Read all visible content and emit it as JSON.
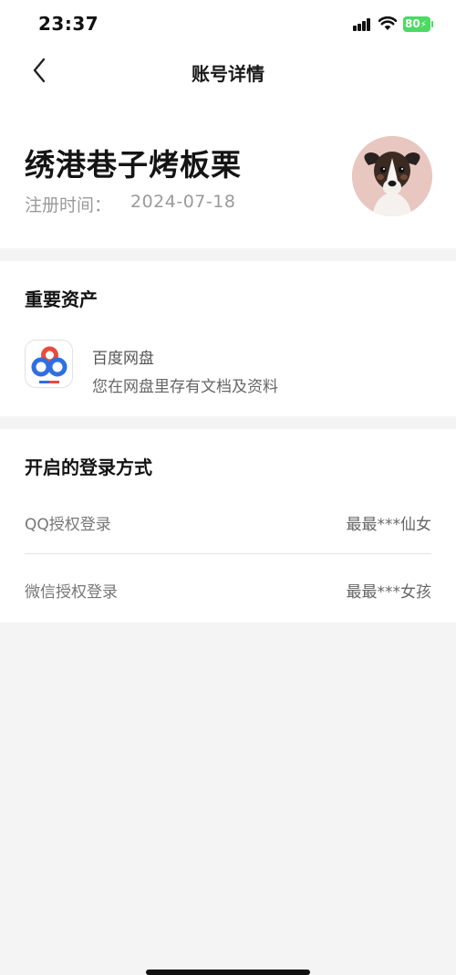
{
  "status_bar": {
    "time": "23:37",
    "battery": "80",
    "icons": [
      "signal-icon",
      "wifi-icon",
      "battery-icon"
    ]
  },
  "nav": {
    "title": "账号详情",
    "back_icon": "chevron-left-icon"
  },
  "profile": {
    "username": "绣港巷子烤板栗",
    "registered_label": "注册时间：",
    "registered_date": "2024-07-18",
    "avatar_icon": "dog-avatar"
  },
  "assets": {
    "section_title": "重要资产",
    "items": [
      {
        "name": "百度网盘",
        "description": "您在网盘里存有文档及资料",
        "icon": "baidu-netdisk-icon"
      }
    ]
  },
  "login_methods": {
    "section_title": "开启的登录方式",
    "items": [
      {
        "method": "QQ授权登录",
        "account": "最最***仙女"
      },
      {
        "method": "微信授权登录",
        "account": "最最***女孩"
      }
    ]
  },
  "colors": {
    "background": "#f4f4f5",
    "card": "#ffffff",
    "battery": "#4cd964",
    "secondary_text": "#9a9a9a"
  }
}
